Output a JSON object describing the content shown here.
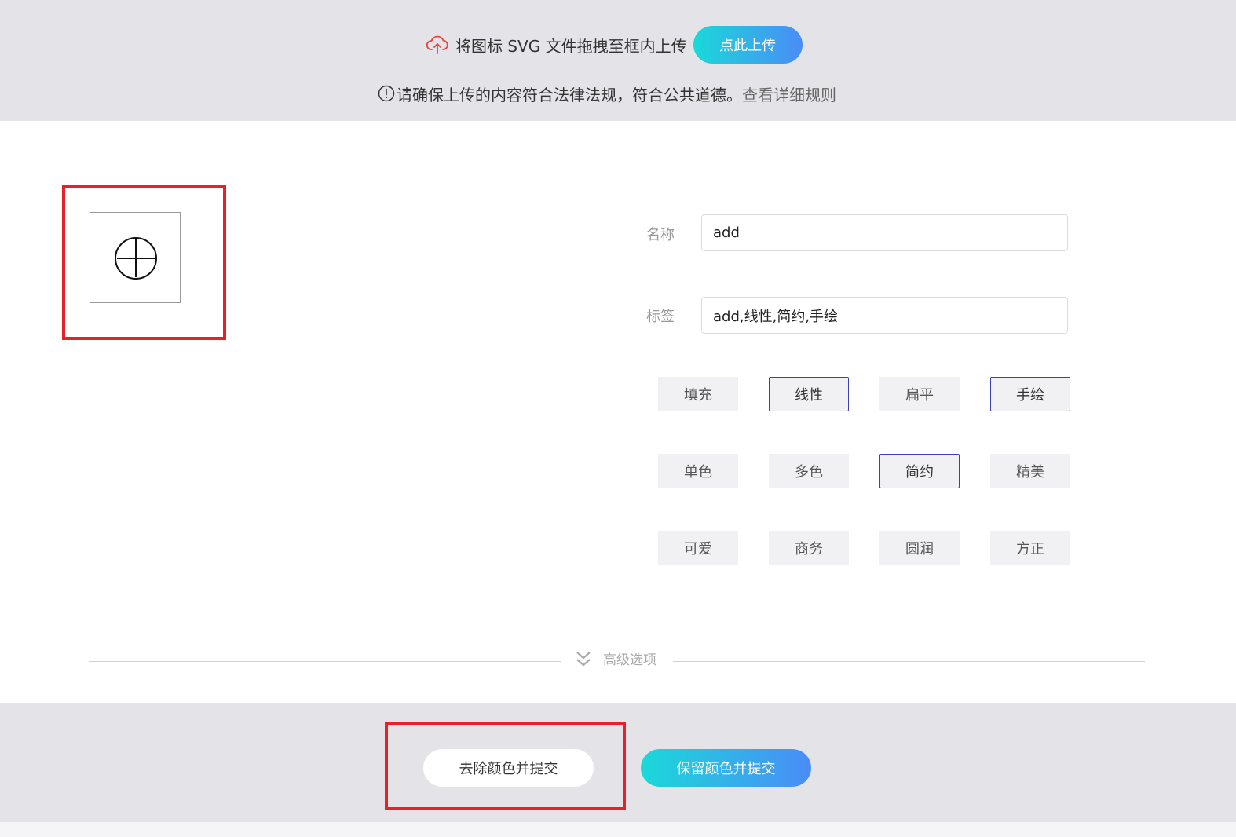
{
  "upload": {
    "hint_text": "将图标 SVG 文件拖拽至框内上传",
    "button_label": "点此上传",
    "notice_text": "请确保上传的内容符合法律法规，符合公共道德。",
    "rules_link": "查看详细规则",
    "icon_color": "#e8453c"
  },
  "form": {
    "name_label": "名称",
    "name_value": "add",
    "tags_label": "标签",
    "tags_value": "add,线性,简约,手绘"
  },
  "tags": [
    [
      {
        "label": "填充",
        "selected": false
      },
      {
        "label": "线性",
        "selected": true
      },
      {
        "label": "扁平",
        "selected": false
      },
      {
        "label": "手绘",
        "selected": true
      }
    ],
    [
      {
        "label": "单色",
        "selected": false
      },
      {
        "label": "多色",
        "selected": false
      },
      {
        "label": "简约",
        "selected": true
      },
      {
        "label": "精美",
        "selected": false
      }
    ],
    [
      {
        "label": "可爱",
        "selected": false
      },
      {
        "label": "商务",
        "selected": false
      },
      {
        "label": "圆润",
        "selected": false
      },
      {
        "label": "方正",
        "selected": false
      }
    ]
  ],
  "advanced": {
    "label": "高级选项"
  },
  "actions": {
    "remove_color_label": "去除颜色并提交",
    "keep_color_label": "保留颜色并提交"
  },
  "colors": {
    "accent_gradient_start": "#1ad9d9",
    "accent_gradient_end": "#4a8cf7",
    "highlight_frame": "#e8202a",
    "selected_tag_border": "#3a3fb6"
  }
}
